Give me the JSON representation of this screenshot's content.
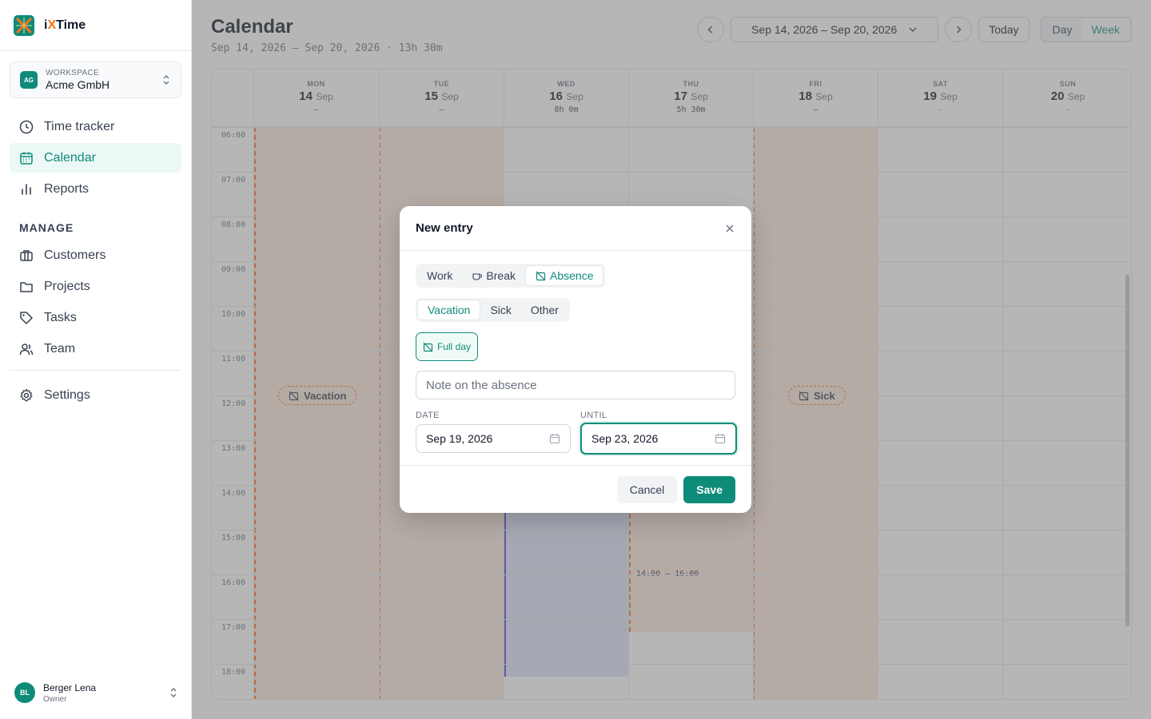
{
  "app": {
    "name_prefix": "i",
    "name_x": "X",
    "name_suffix": "Time",
    "accent": "#0f8b7a"
  },
  "workspace": {
    "label": "WORKSPACE",
    "name": "Acme GmbH",
    "badge": "AG"
  },
  "nav": {
    "items": [
      {
        "label": "Time tracker",
        "icon": "clock-icon"
      },
      {
        "label": "Calendar",
        "icon": "calendar-icon",
        "active": true
      },
      {
        "label": "Reports",
        "icon": "bar-chart-icon"
      }
    ],
    "manage_label": "MANAGE",
    "manage_items": [
      {
        "label": "Customers",
        "icon": "briefcase-icon"
      },
      {
        "label": "Projects",
        "icon": "folder-icon"
      },
      {
        "label": "Tasks",
        "icon": "tag-icon"
      },
      {
        "label": "Team",
        "icon": "users-icon"
      }
    ],
    "settings": {
      "label": "Settings",
      "icon": "gear-icon"
    }
  },
  "user": {
    "name": "Berger Lena",
    "role": "Owner",
    "initials": "BL"
  },
  "header": {
    "title": "Calendar",
    "subtitle": "Sep 14, 2026 – Sep 20, 2026 · 13h 30m",
    "range": "Sep 14, 2026 – Sep 20, 2026",
    "today": "Today",
    "view_day": "Day",
    "view_week": "Week"
  },
  "calendar": {
    "days": [
      {
        "name": "MON",
        "num": "14",
        "month": "Sep",
        "total": "–"
      },
      {
        "name": "TUE",
        "num": "15",
        "month": "Sep",
        "total": "–"
      },
      {
        "name": "WED",
        "num": "16",
        "month": "Sep",
        "total": "8h 0m"
      },
      {
        "name": "THU",
        "num": "17",
        "month": "Sep",
        "total": "5h 30m"
      },
      {
        "name": "FRI",
        "num": "18",
        "month": "Sep",
        "total": "–"
      },
      {
        "name": "SAT",
        "num": "19",
        "month": "Sep",
        "total": "–"
      },
      {
        "name": "SUN",
        "num": "20",
        "month": "Sep",
        "total": "–"
      }
    ],
    "hours": [
      "06:00",
      "07:00",
      "08:00",
      "09:00",
      "10:00",
      "11:00",
      "12:00",
      "13:00",
      "14:00",
      "15:00",
      "16:00",
      "17:00",
      "18:00"
    ],
    "vacation_label": "Vacation",
    "sick_label": "Sick",
    "thu_break_time": "14:00 – 16:00"
  },
  "modal": {
    "title": "New entry",
    "tabs": [
      "Work",
      "Break",
      "Absence"
    ],
    "active_tab": "Absence",
    "subtabs": [
      "Vacation",
      "Sick",
      "Other"
    ],
    "active_subtab": "Vacation",
    "full_day": "Full day",
    "note_placeholder": "Note on the absence",
    "date_label": "DATE",
    "date_value": "Sep 19, 2026",
    "until_label": "UNTIL",
    "until_value": "Sep 23, 2026",
    "cancel": "Cancel",
    "save": "Save"
  }
}
